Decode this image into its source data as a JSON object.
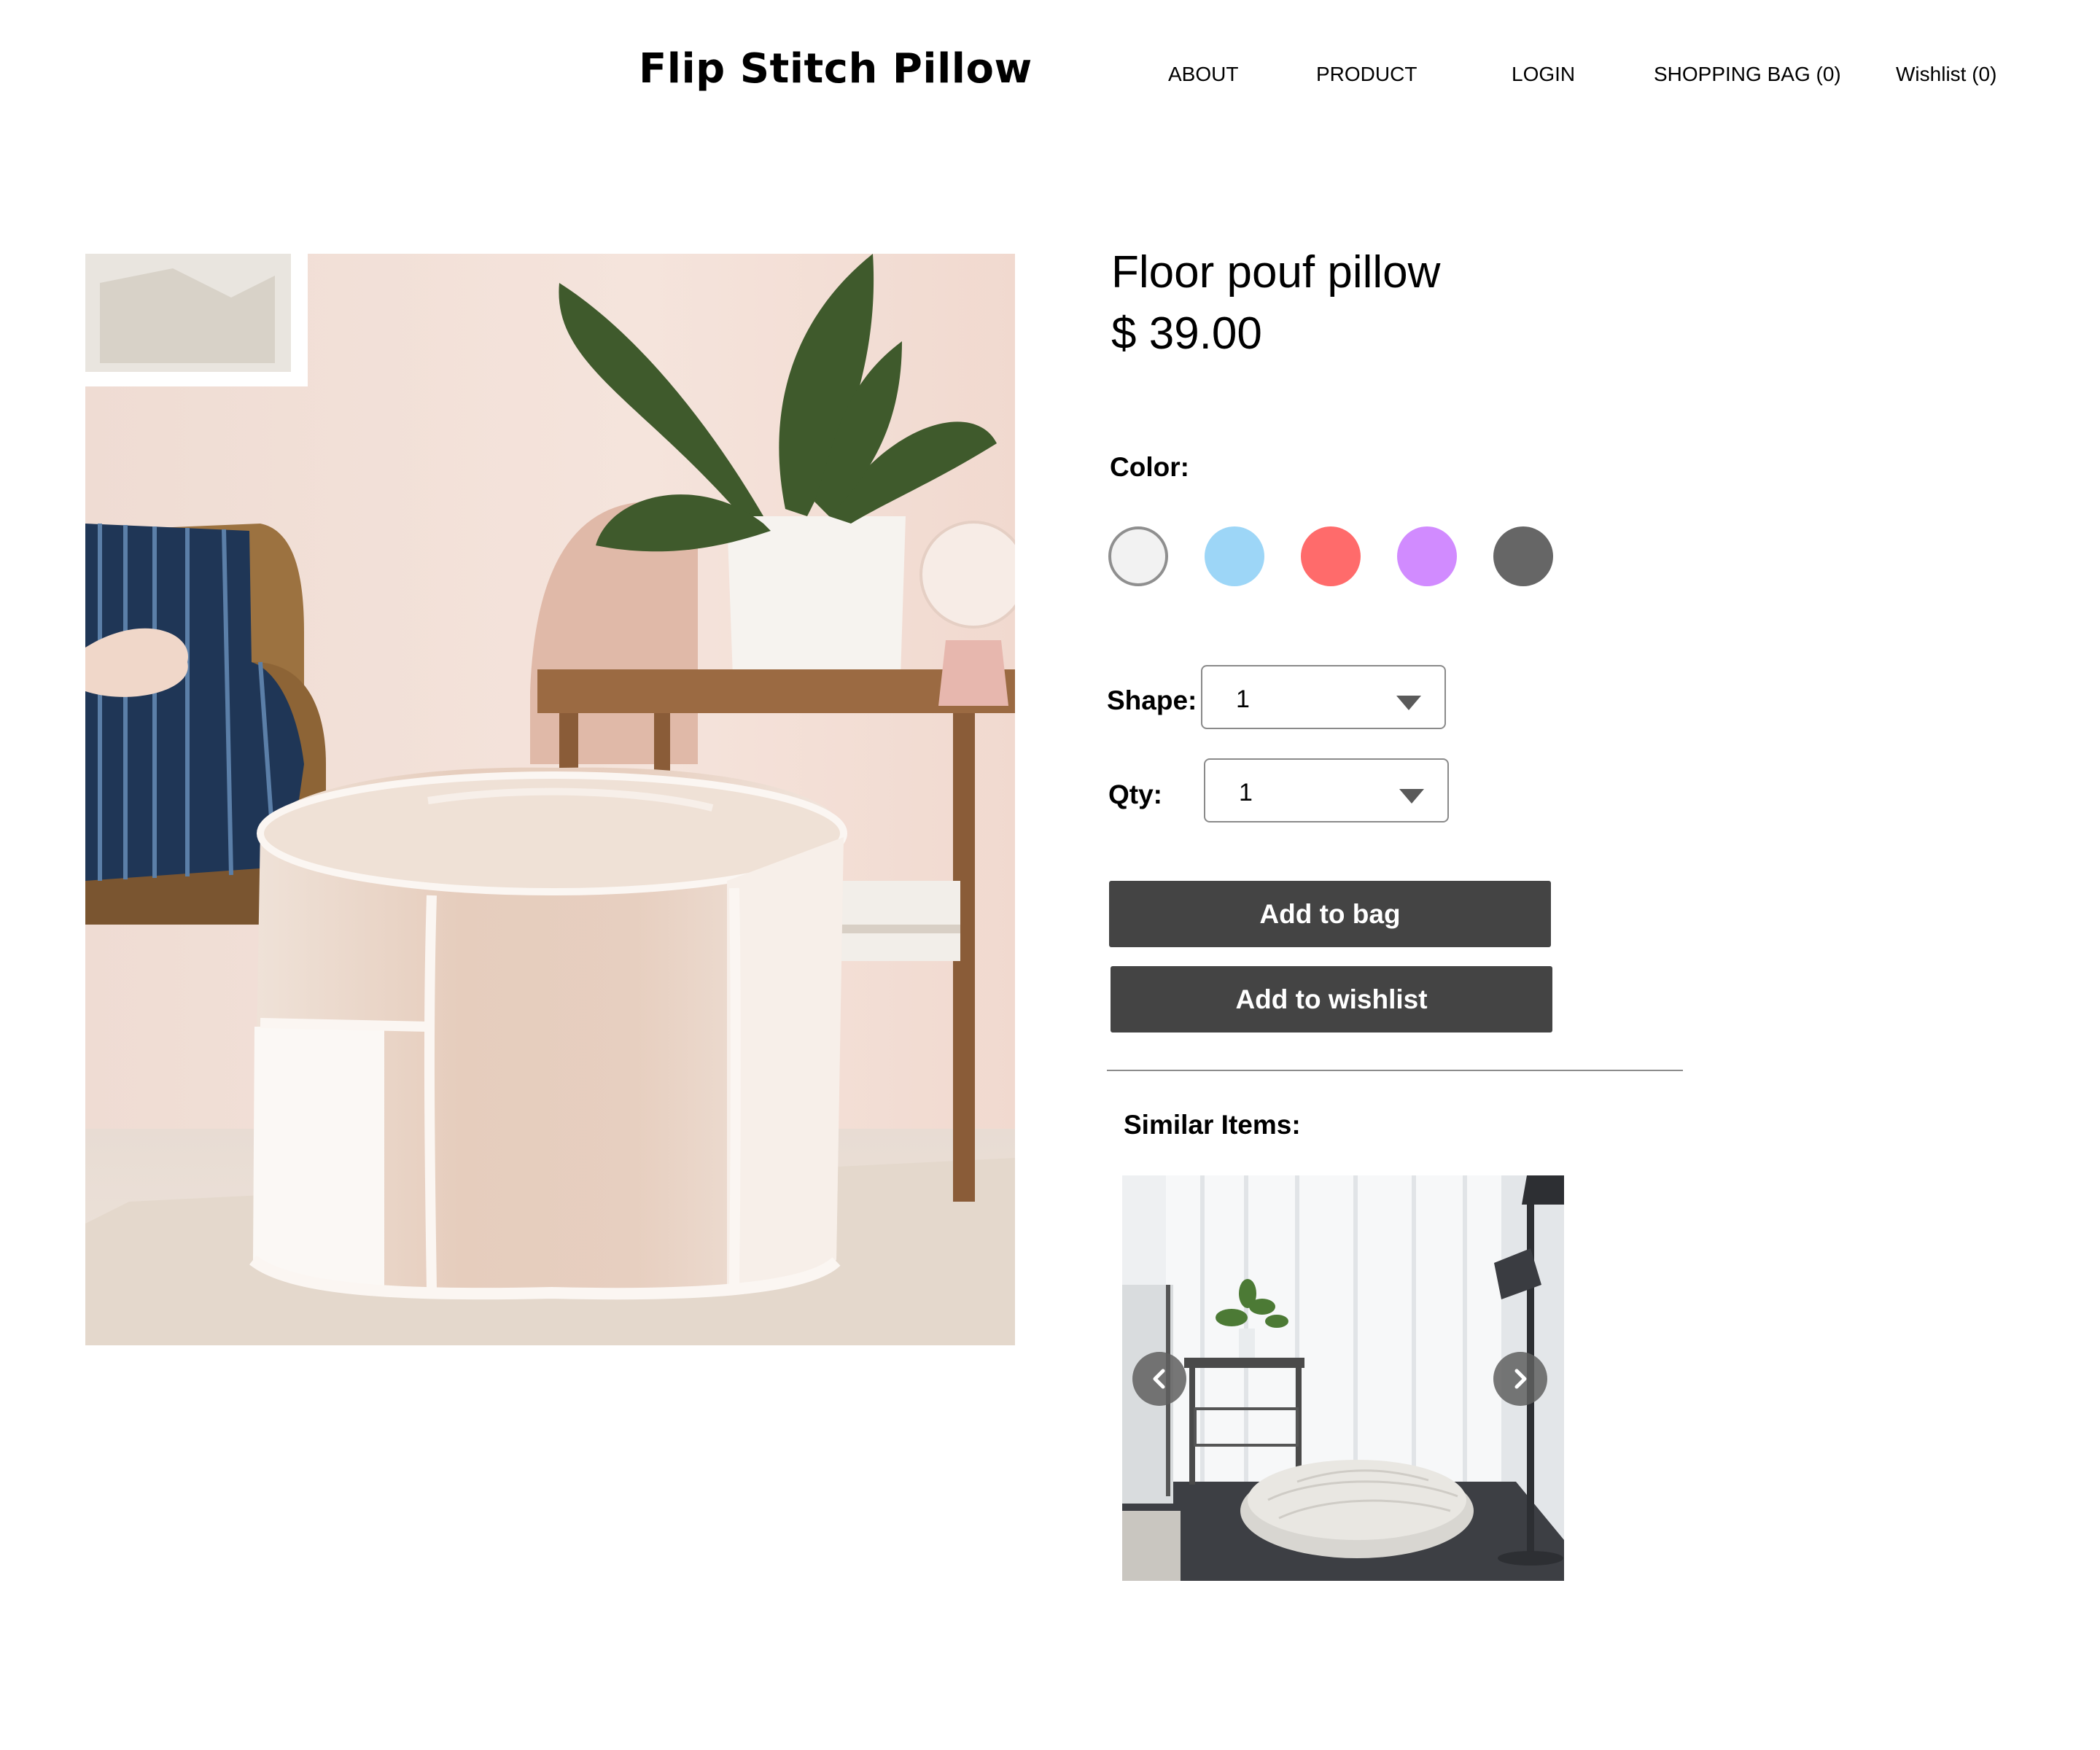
{
  "header": {
    "brand": "Flip Stitch Pillow",
    "nav": [
      {
        "label": "ABOUT"
      },
      {
        "label": "PRODUCT"
      },
      {
        "label": "LOGIN"
      },
      {
        "label": "SHOPPING BAG (0)"
      },
      {
        "label": "Wishlist (0)"
      }
    ]
  },
  "product": {
    "title": "Floor pouf pillow",
    "price": "$ 39.00",
    "color_label": "Color:",
    "colors": [
      "#f2f2f2",
      "#9dd6f7",
      "#ff6b6b",
      "#d18bff",
      "#666666"
    ],
    "shape_label": "Shape:",
    "shape_value": "1",
    "qty_label": "Qty:",
    "qty_value": "1",
    "add_to_bag": "Add to bag",
    "add_to_wishlist": "Add to wishlist"
  },
  "similar": {
    "label": "Similar Items:",
    "prev_icon": "chevron-left-icon",
    "next_icon": "chevron-right-icon"
  }
}
